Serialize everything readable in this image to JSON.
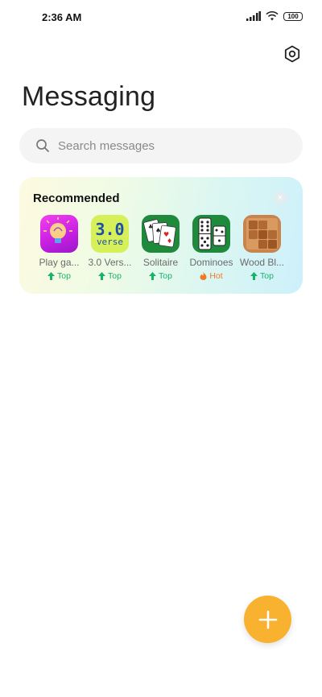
{
  "status_bar": {
    "time": "2:36 AM",
    "battery": "100"
  },
  "header": {
    "title": "Messaging",
    "settings_icon": "gear-icon"
  },
  "search": {
    "placeholder": "Search messages",
    "value": "",
    "icon": "search-icon"
  },
  "recommended": {
    "title": "Recommended",
    "close_symbol": "×",
    "apps": [
      {
        "name": "Play ga...",
        "tag": "Top",
        "tag_type": "top",
        "icon": "lightbulb-icon"
      },
      {
        "name": "3.0 Vers...",
        "tag": "Top",
        "tag_type": "top",
        "icon": "verse-icon",
        "icon_text_top": "3.0",
        "icon_text_bottom": "verse"
      },
      {
        "name": "Solitaire",
        "tag": "Top",
        "tag_type": "top",
        "icon": "cards-icon"
      },
      {
        "name": "Dominoes",
        "tag": "Hot",
        "tag_type": "hot",
        "icon": "domino-icon"
      },
      {
        "name": "Wood Bl...",
        "tag": "Top",
        "tag_type": "top",
        "icon": "wood-block-icon"
      }
    ]
  },
  "fab": {
    "symbol": "+",
    "color": "#f8b230"
  },
  "colors": {
    "accent": "#f8b230",
    "top_tag": "#17b36b",
    "hot_tag": "#f0782a"
  }
}
